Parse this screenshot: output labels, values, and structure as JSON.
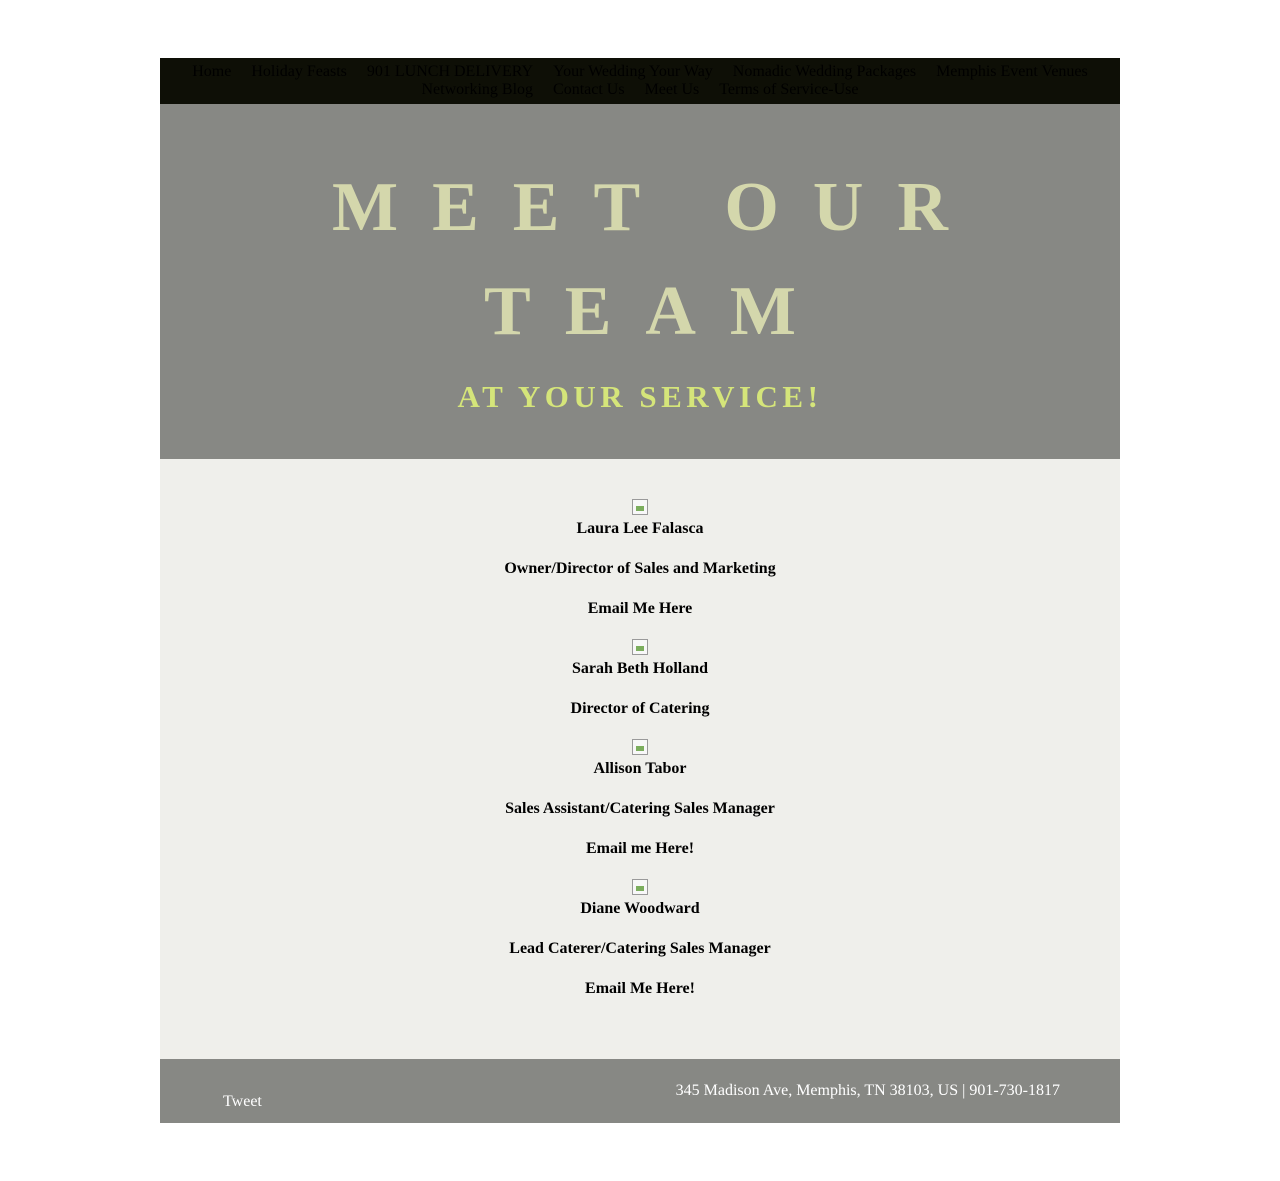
{
  "nav": {
    "items": [
      "Home",
      "Holiday Feasts",
      "901 LUNCH DELIVERY",
      "Your Wedding Your Way",
      "Nomadic Wedding Packages",
      "Memphis Event Venues",
      "Networking Blog",
      "Contact Us",
      "Meet Us",
      "Terms of Service-Use"
    ]
  },
  "hero": {
    "title_line1": "MEET OUR",
    "title_line2": "TEAM",
    "subtitle": "AT YOUR SERVICE!"
  },
  "team": [
    {
      "name": "Laura Lee Falasca",
      "role": "Owner/Director of Sales and Marketing",
      "email_link": "Email Me Here"
    },
    {
      "name": "Sarah Beth Holland",
      "role": "Director of Catering"
    },
    {
      "name": "Allison Tabor",
      "role": "Sales Assistant/Catering Sales Manager",
      "email_link": "Email me Here!"
    },
    {
      "name": "Diane Woodward",
      "role": "Lead Caterer/Catering Sales Manager",
      "email_link": "Email Me Here!"
    }
  ],
  "footer": {
    "tweet_label": "Tweet",
    "contact": "345 Madison Ave, Memphis, TN 38103, US | 901-730-1817"
  },
  "colors": {
    "nav_bg": "#0e0f06",
    "hero_bg": "#878884",
    "title": "#d4d7ac",
    "subtitle": "#d5e57a",
    "content_bg": "#efefeb"
  }
}
